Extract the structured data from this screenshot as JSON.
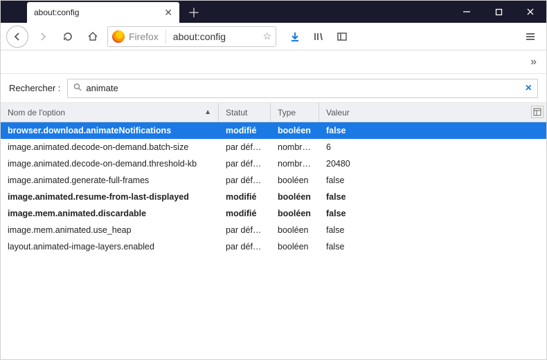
{
  "window": {
    "tab_title": "about:config"
  },
  "urlbar": {
    "context_label": "Firefox",
    "url": "about:config"
  },
  "overflow": {},
  "search": {
    "label": "Rechercher :",
    "value": "animate",
    "placeholder": ""
  },
  "columns": {
    "option": "Nom de l'option",
    "status": "Statut",
    "type": "Type",
    "value": "Valeur"
  },
  "rows": [
    {
      "name": "browser.download.animateNotifications",
      "status": "modifié",
      "type": "booléen",
      "value": "false",
      "modified": true,
      "selected": true
    },
    {
      "name": "image.animated.decode-on-demand.batch-size",
      "status": "par défaut",
      "type": "nombre en...",
      "value": "6",
      "modified": false,
      "selected": false
    },
    {
      "name": "image.animated.decode-on-demand.threshold-kb",
      "status": "par défaut",
      "type": "nombre en...",
      "value": "20480",
      "modified": false,
      "selected": false
    },
    {
      "name": "image.animated.generate-full-frames",
      "status": "par défaut",
      "type": "booléen",
      "value": "false",
      "modified": false,
      "selected": false
    },
    {
      "name": "image.animated.resume-from-last-displayed",
      "status": "modifié",
      "type": "booléen",
      "value": "false",
      "modified": true,
      "selected": false
    },
    {
      "name": "image.mem.animated.discardable",
      "status": "modifié",
      "type": "booléen",
      "value": "false",
      "modified": true,
      "selected": false
    },
    {
      "name": "image.mem.animated.use_heap",
      "status": "par défaut",
      "type": "booléen",
      "value": "false",
      "modified": false,
      "selected": false
    },
    {
      "name": "layout.animated-image-layers.enabled",
      "status": "par défaut",
      "type": "booléen",
      "value": "false",
      "modified": false,
      "selected": false
    }
  ]
}
